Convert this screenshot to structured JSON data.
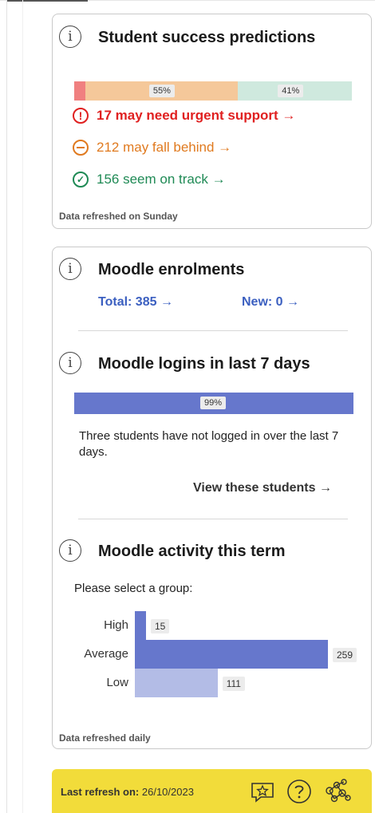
{
  "predictions": {
    "title": "Student success predictions",
    "bar": {
      "urgent_percent": 4,
      "behind_percent": 55,
      "ontrack_percent": 41,
      "behind_label": "55%",
      "ontrack_label": "41%",
      "colors": {
        "urgent": "#f08080",
        "behind": "#f5c89a",
        "ontrack": "#cfe9de"
      }
    },
    "urgent": "17 may need urgent support →",
    "behind": "212 may fall behind →",
    "ontrack": "156 seem on track →",
    "footnote": "Data refreshed on Sunday",
    "colors": {
      "urgent": "#e02020",
      "behind": "#e07a1f",
      "ontrack": "#1f8a55"
    }
  },
  "enrolments": {
    "title": "Moodle enrolments",
    "total": "Total: 385 →",
    "new": "New: 0 →"
  },
  "logins": {
    "title": "Moodle logins in last 7 days",
    "percent": 99,
    "percent_label": "99%",
    "text": "Three students have not logged in over the last 7 days.",
    "view_link": "View these students →"
  },
  "activity": {
    "title": "Moodle activity this term",
    "prompt": "Please select a group:",
    "max": 259,
    "bars": [
      {
        "label": "High",
        "value": 15,
        "value_label": "15",
        "color": "#6677cc"
      },
      {
        "label": "Average",
        "value": 259,
        "value_label": "259",
        "color": "#6677cc"
      },
      {
        "label": "Low",
        "value": 111,
        "value_label": "111",
        "color": "#b3bce6"
      }
    ],
    "footnote": "Data refreshed daily"
  },
  "footer": {
    "label": "Last refresh on:",
    "date": "26/10/2023",
    "icons": [
      "feedback-star-icon",
      "help-icon",
      "network-icon"
    ],
    "background": "#f2dc3a"
  }
}
